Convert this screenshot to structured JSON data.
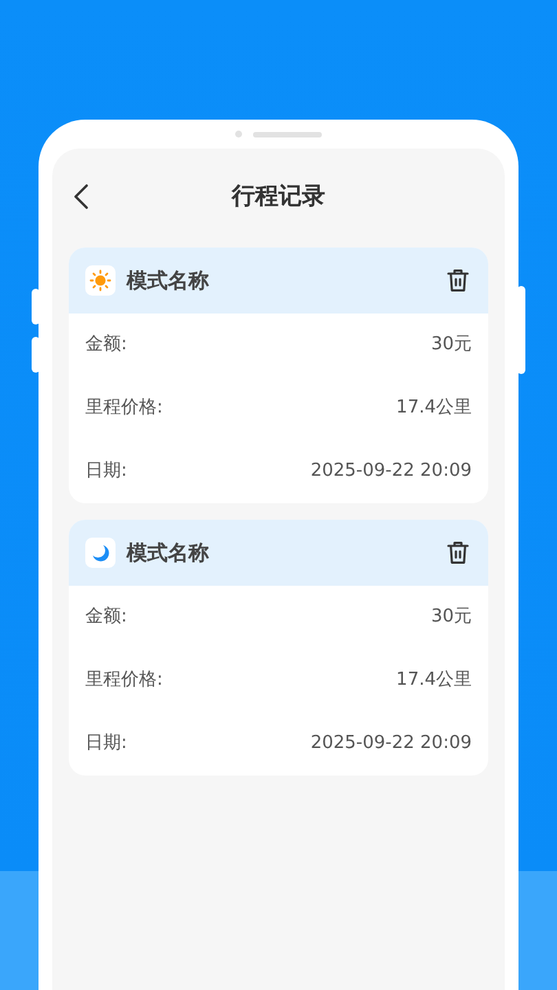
{
  "header": {
    "title": "行程记录"
  },
  "trips": [
    {
      "kind": "day",
      "name": "模式名称",
      "fields": [
        {
          "label": "金额:",
          "value": "30元"
        },
        {
          "label": "里程价格:",
          "value": "17.4公里"
        },
        {
          "label": "日期:",
          "value": "2025-09-22 20:09"
        }
      ]
    },
    {
      "kind": "night",
      "name": "模式名称",
      "fields": [
        {
          "label": "金额:",
          "value": "30元"
        },
        {
          "label": "里程价格:",
          "value": "17.4公里"
        },
        {
          "label": "日期:",
          "value": "2025-09-22 20:09"
        }
      ]
    }
  ]
}
